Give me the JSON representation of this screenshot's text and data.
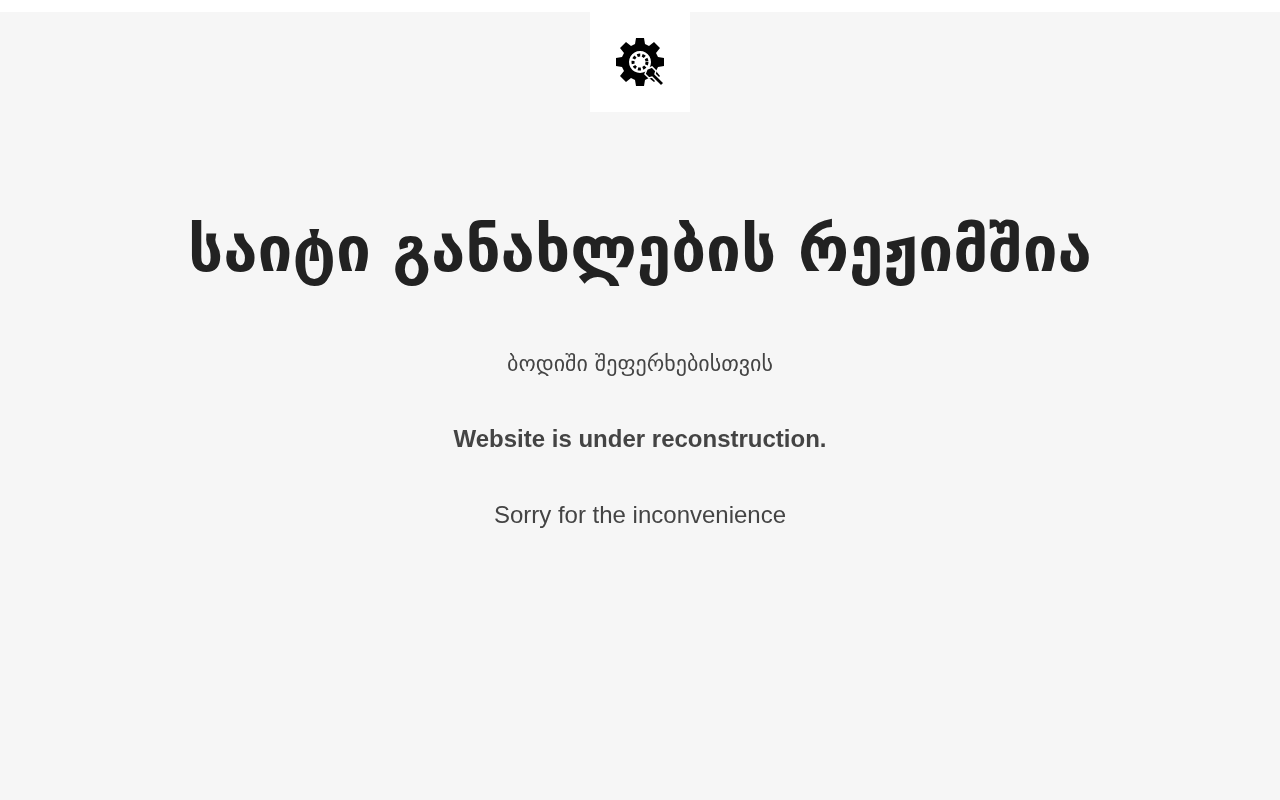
{
  "heading": "საიტი განახლების რეჟიმშია",
  "subheading": "ბოდიში შეფერხებისთვის",
  "notice": "Website is under reconstruction.",
  "apology": "Sorry for the inconvenience"
}
